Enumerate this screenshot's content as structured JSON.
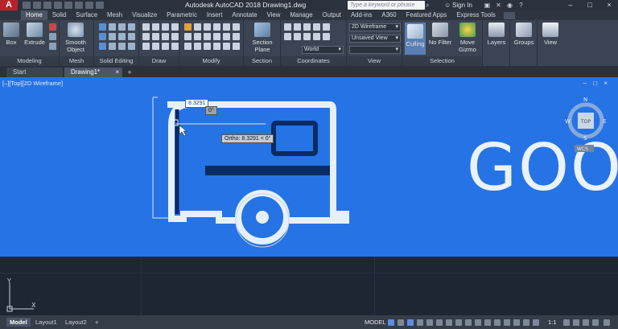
{
  "app": {
    "logo": "A",
    "title": "Autodesk AutoCAD 2018   Drawing1.dwg",
    "search_placeholder": "Type a keyword or phrase",
    "signin": "Sign In"
  },
  "ribbon_tabs": [
    "Home",
    "Solid",
    "Surface",
    "Mesh",
    "Visualize",
    "Parametric",
    "Insert",
    "Annotate",
    "View",
    "Manage",
    "Output",
    "Add-ins",
    "A360",
    "Featured Apps",
    "Express Tools"
  ],
  "active_tab": "Home",
  "ribbon": {
    "box": "Box",
    "extrude": "Extrude",
    "smooth_object": "Smooth Object",
    "section_plane": "Section Plane",
    "culling": "Culling",
    "no_filter": "No Filter",
    "move_gizmo": "Move Gizmo",
    "layers": "Layers",
    "groups": "Groups",
    "view": "View",
    "visual_style": "2D Wireframe",
    "saved_view": "Unsaved View",
    "ucs": "World",
    "groups_labels": [
      "Modeling",
      "Mesh",
      "Solid Editing",
      "Draw",
      "Modify",
      "Section",
      "Coordinates",
      "View",
      "Selection"
    ]
  },
  "file_tabs": [
    "Start",
    "Drawing1*"
  ],
  "viewport": {
    "label": "[–][Top][2D Wireframe]",
    "controls": "– □ ×",
    "dyn_input_1": "8.3291",
    "dyn_input_2": "0°",
    "ortho_tooltip": "Ortho: 8.3291 < 0°",
    "big_text": "GOO",
    "viewcube": {
      "n": "N",
      "s": "S",
      "e": "E",
      "w": "W",
      "top": "TOP",
      "wcs": "WCS"
    }
  },
  "ucs": {
    "y": "Y",
    "x": "X"
  },
  "layout_tabs": [
    "Model",
    "Layout1",
    "Layout2"
  ],
  "status": {
    "model": "MODEL",
    "scale": "1:1"
  },
  "colors": {
    "viewport_bg": "#2673e6",
    "accent_red": "#b9222b"
  }
}
